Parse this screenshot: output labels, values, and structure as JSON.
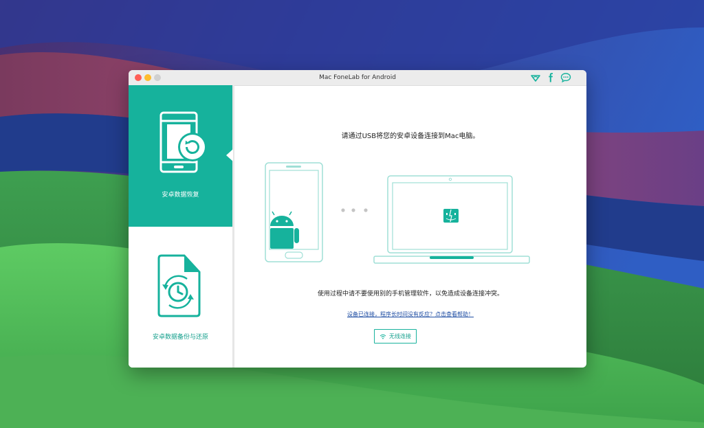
{
  "window": {
    "title": "Mac FoneLab for Android"
  },
  "toolbar_icons": [
    "wifi-diamond-icon",
    "facebook-icon",
    "chat-bubble-icon"
  ],
  "sidebar": {
    "items": [
      {
        "label": "安卓数据恢复",
        "icon": "phone-restore-icon",
        "active": true
      },
      {
        "label": "安卓数据备份与还原",
        "icon": "document-backup-icon",
        "active": false
      }
    ]
  },
  "main": {
    "instruction": "请通过USB将您的安卓设备连接到Mac电脑。",
    "warning": "使用过程中请不要使用别的手机管理软件，以免造成设备连接冲突。",
    "help_link": "设备已连接，程序长时间没有反应？点击查看帮助！",
    "wifi_button": "无线连接"
  },
  "colors": {
    "accent": "#16b29c",
    "link": "#1f4ea3"
  }
}
